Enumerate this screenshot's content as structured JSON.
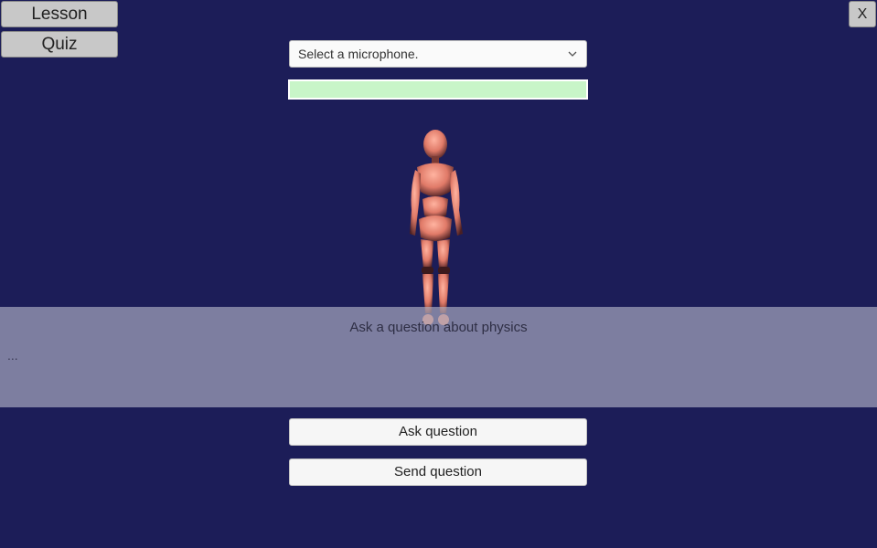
{
  "nav": {
    "lesson_label": "Lesson",
    "quiz_label": "Quiz"
  },
  "window": {
    "close_label": "X"
  },
  "microphone": {
    "selected": "Select a microphone.",
    "icon": "chevron-down-icon"
  },
  "level_meter": {
    "fill_fraction": 1.0,
    "fill_color": "#c8f5c8"
  },
  "question_panel": {
    "title": "Ask a question about physics",
    "answer": "..."
  },
  "actions": {
    "ask_label": "Ask question",
    "send_label": "Send question"
  },
  "colors": {
    "background": "#1c1d58",
    "avatar_skin": "#e88070"
  }
}
